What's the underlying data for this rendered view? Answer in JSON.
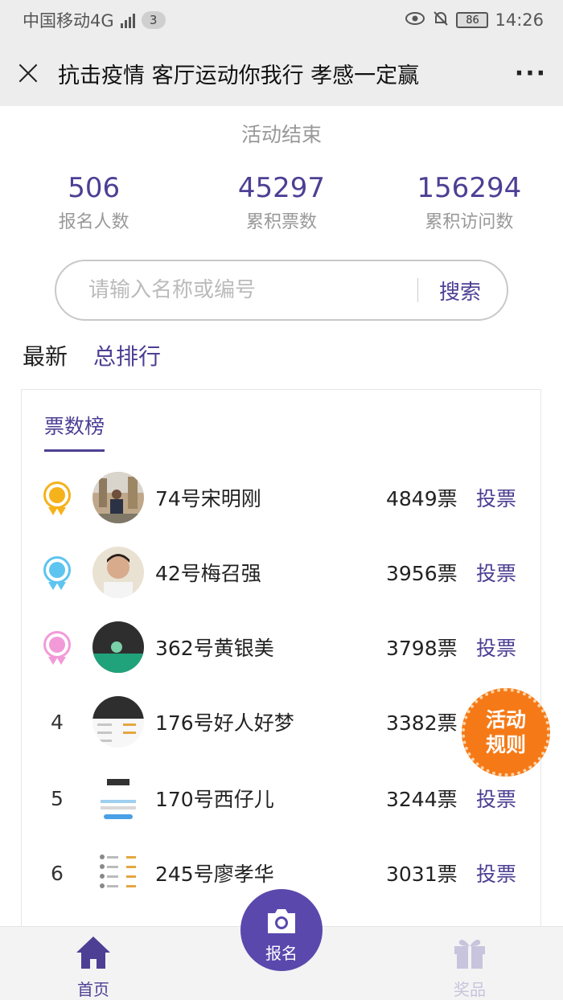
{
  "statusbar": {
    "carrier": "中国移动4G",
    "net": "4G",
    "sim": "3",
    "battery": "86",
    "time": "14:26"
  },
  "navbar": {
    "title": "抗击疫情 客厅运动你我行 孝感一定赢",
    "more": "···"
  },
  "activity_status": "活动结束",
  "stats": [
    {
      "value": "506",
      "label": "报名人数"
    },
    {
      "value": "45297",
      "label": "累积票数"
    },
    {
      "value": "156294",
      "label": "累积访问数"
    }
  ],
  "search": {
    "placeholder": "请输入名称或编号",
    "button": "搜索"
  },
  "tabs": {
    "latest": "最新",
    "total": "总排行"
  },
  "leaderboard": {
    "title": "票数榜",
    "vote_label": "投票",
    "rows": [
      {
        "rank": "1",
        "name": "74号宋明刚",
        "votes": "4849票"
      },
      {
        "rank": "2",
        "name": "42号梅召强",
        "votes": "3956票"
      },
      {
        "rank": "3",
        "name": "362号黄银美",
        "votes": "3798票"
      },
      {
        "rank": "4",
        "name": "176号好人好梦",
        "votes": "3382票"
      },
      {
        "rank": "5",
        "name": "170号西仔儿",
        "votes": "3244票"
      },
      {
        "rank": "6",
        "name": "245号廖孝华",
        "votes": "3031票"
      }
    ]
  },
  "rule_badge": {
    "line1": "活动",
    "line2": "规则"
  },
  "tabbar": {
    "home": "首页",
    "signup": "报名",
    "prize": "奖品"
  },
  "colors": {
    "accent": "#4d3f94",
    "gold": "#f5b21a",
    "silver": "#5ec4f0",
    "bronze": "#f29ad8",
    "badge": "#f57a17"
  }
}
